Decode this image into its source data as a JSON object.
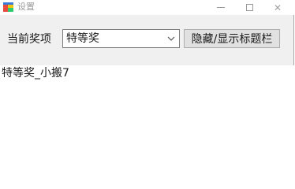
{
  "window": {
    "title": "设置",
    "icon": "app-window-icon",
    "controls": {
      "minimize": "minimize-icon",
      "maximize": "maximize-icon",
      "close_glyph": "✕"
    }
  },
  "toolbar": {
    "prize_label": "当前奖项",
    "prize_select": {
      "selected": "特等奖"
    },
    "toggle_titlebar_label": "隐藏/显示标题栏"
  },
  "content": {
    "result_text": "特等奖_小搬7"
  }
}
